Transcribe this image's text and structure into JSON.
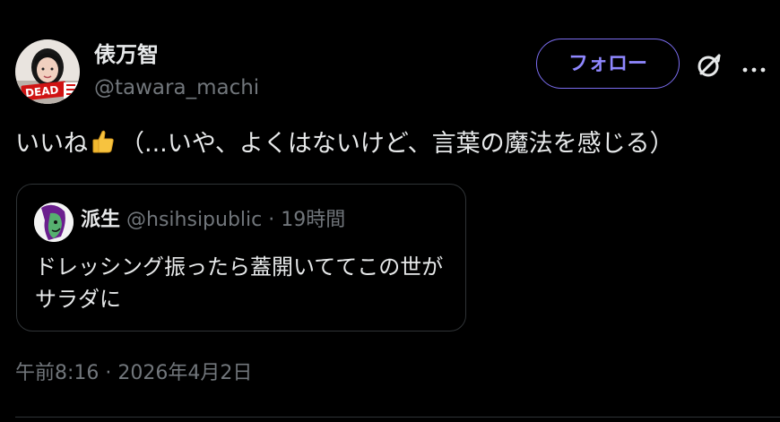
{
  "author": {
    "display_name": "俵万智",
    "handle": "@tawara_machi",
    "avatar_badge_text": "DEAD"
  },
  "actions": {
    "follow_label": "フォロー",
    "grok_icon": "grok-icon",
    "more_icon": "more-icon"
  },
  "tweet": {
    "text_before_emoji": "いいね",
    "emoji": "thumbs-up",
    "text_after_emoji": "（...いや、よくはないけど、言葉の魔法を感じる）"
  },
  "quote": {
    "display_name": "派生",
    "handle": "@hsihsipublic",
    "separator": "·",
    "time": "19時間",
    "text": "ドレッシング振ったら蓋開いててこの世がサラダに"
  },
  "timestamp": "午前8:16 · 2026年4月2日",
  "colors": {
    "background": "#000000",
    "text": "#e7e9ea",
    "secondary": "#71767b",
    "follow_accent": "#8f87ff",
    "border": "#2f3336"
  }
}
